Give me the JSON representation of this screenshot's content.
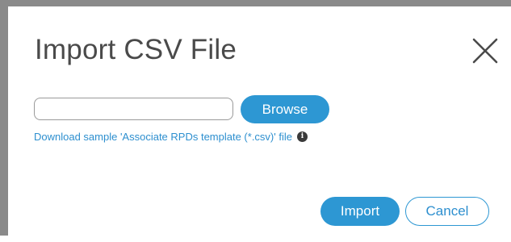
{
  "dialog": {
    "title": "Import CSV File",
    "close_icon": "close-icon"
  },
  "file_picker": {
    "value": "",
    "placeholder": "",
    "browse_label": "Browse"
  },
  "download": {
    "link_text": "Download sample 'Associate RPDs template (*.csv)' file",
    "info_icon": "info-icon",
    "info_glyph": "i"
  },
  "actions": {
    "import_label": "Import",
    "cancel_label": "Cancel"
  },
  "colors": {
    "accent": "#2d97d3",
    "title_text": "#4a4a4a",
    "frame_border": "#8a8a8a"
  }
}
